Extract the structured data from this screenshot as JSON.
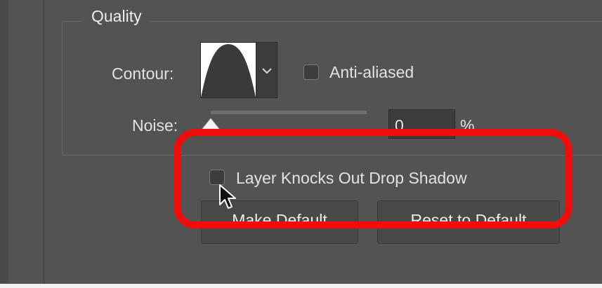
{
  "quality": {
    "title": "Quality",
    "contour_label": "Contour:",
    "contour_icon": "contour-curve-icon",
    "anti_aliased_label": "Anti-aliased",
    "anti_aliased_checked": false,
    "noise_label": "Noise:",
    "noise_value": "0",
    "noise_unit": "%"
  },
  "options": {
    "knockout_label": "Layer Knocks Out Drop Shadow",
    "knockout_checked": false
  },
  "buttons": {
    "make_default": "Make Default",
    "reset_default": "Reset to Default"
  },
  "colors": {
    "panel_bg": "#535353",
    "field_bg": "#3c3c3c",
    "highlight": "#ee0e0e"
  }
}
